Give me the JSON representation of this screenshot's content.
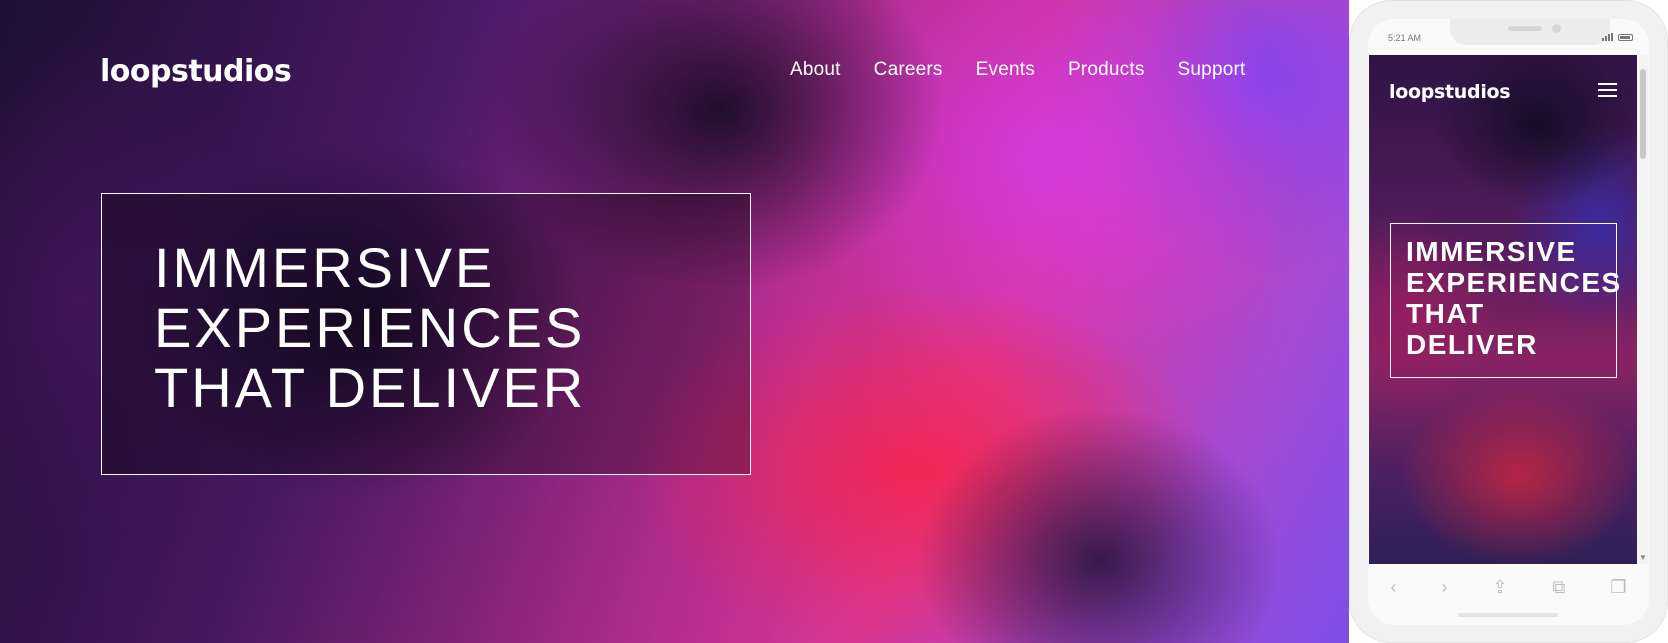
{
  "desktop": {
    "logo": "loopstudios",
    "nav": [
      "About",
      "Careers",
      "Events",
      "Products",
      "Support"
    ],
    "hero_title": "IMMERSIVE EXPERIENCES THAT DELIVER"
  },
  "mobile": {
    "status_time": "5:21 AM",
    "logo": "loopstudios",
    "hero_title": "IMMERSIVE EXPERIENCES THAT DELIVER",
    "menu_icon": "hamburger-menu-icon",
    "toolbar_icons": [
      "back-arrow-icon",
      "forward-arrow-icon",
      "share-icon",
      "bookmarks-icon",
      "tabs-icon"
    ]
  },
  "colors": {
    "text": "#ffffff",
    "hero_border": "#ffffff",
    "phone_frame": "#f1f1f1"
  }
}
